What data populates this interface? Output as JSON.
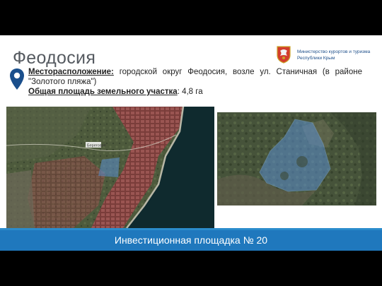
{
  "slide": {
    "title": "Феодосия",
    "ministry": "Министерство курортов и туризма Республики Крым",
    "location_label": "Месторасположение:",
    "location_text": " городской округ Феодосия, возле ул. Станичная (в районе \"Золотого пляжа\")",
    "area_label": "Общая площадь земельного участка",
    "area_value": ": 4,8 га",
    "footer": "Инвестиционная площадка № 20"
  },
  "maps": {
    "left_label": "Береговое"
  },
  "colors": {
    "footer_bg": "#1f78bd",
    "title": "#555a60",
    "ministry_text": "#1e4f8a",
    "pin": "#1a4f8c",
    "sea": "#0f2a2e",
    "highlight": "#5b8fd0"
  },
  "icons": {
    "pin": "location-pin-icon",
    "emblem": "crimea-emblem-icon"
  }
}
